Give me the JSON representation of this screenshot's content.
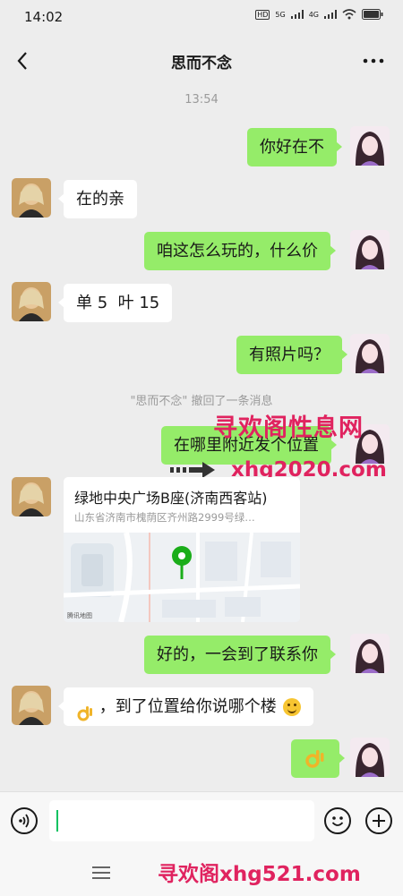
{
  "status_bar": {
    "time": "14:02",
    "hd": "HD",
    "net1": "5G",
    "net2": "4G"
  },
  "header": {
    "title": "思而不念",
    "back_icon": "chevron-left-icon",
    "more_icon": "more-dots-icon"
  },
  "timestamp": "13:54",
  "messages": [
    {
      "side": "right",
      "text": "你好在不"
    },
    {
      "side": "left",
      "text": "在的亲"
    },
    {
      "side": "right",
      "text": "咱这怎么玩的，什么价"
    },
    {
      "side": "left",
      "text": "单 5  叶 15"
    },
    {
      "side": "right",
      "text": "有照片吗？"
    },
    {
      "side": "right",
      "text": "在哪里附近发个位置"
    },
    {
      "side": "right",
      "text": "好的，一会到了联系你"
    },
    {
      "side": "left",
      "text": "，到了位置给你说哪个楼"
    }
  ],
  "recall_notice": "\"思而不念\" 撤回了一条消息",
  "location_card": {
    "title": "绿地中央广场B座(济南西客站)",
    "address": "山东省济南市槐荫区齐州路2999号绿…",
    "map_label": "腾讯地图"
  },
  "watermarks": {
    "top": "寻欢阁性息网",
    "mid": "xhg2020.com",
    "bottom": "寻欢阁xhg521.com"
  },
  "input": {
    "value": "",
    "placeholder": ""
  },
  "colors": {
    "background": "#ededed",
    "sent_bubble": "#95ec69",
    "received_bubble": "#ffffff",
    "watermark": "#e0235f",
    "cursor": "#07c160"
  }
}
